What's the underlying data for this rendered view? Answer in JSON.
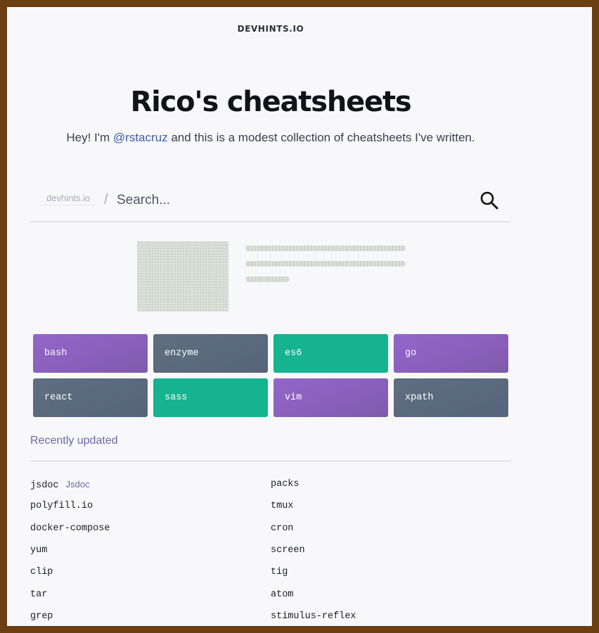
{
  "site": {
    "brand": "DEVHINTS.IO"
  },
  "hero": {
    "title": "Rico's cheatsheets",
    "subtitle_before": "Hey! I'm ",
    "subtitle_link": "@rstacruz",
    "subtitle_after": " and this is a modest collection of cheatsheets I've written."
  },
  "search": {
    "domain_label": "devhints.io",
    "separator": "/",
    "placeholder": "Search...",
    "icon": "search-icon"
  },
  "colors": {
    "purple": "#8a5fbc",
    "slate": "#5a6a7e",
    "green": "#15b38f",
    "link": "#3b5ea8",
    "accent": "#6a68a6"
  },
  "tiles": [
    {
      "label": "bash",
      "color": "purple"
    },
    {
      "label": "enzyme",
      "color": "slate"
    },
    {
      "label": "es6",
      "color": "green"
    },
    {
      "label": "go",
      "color": "purple"
    },
    {
      "label": "react",
      "color": "slate"
    },
    {
      "label": "sass",
      "color": "green"
    },
    {
      "label": "vim",
      "color": "purple"
    },
    {
      "label": "xpath",
      "color": "slate"
    }
  ],
  "recent": {
    "heading": "Recently updated",
    "left": [
      {
        "label": "jsdoc",
        "tag": "Jsdoc"
      },
      {
        "label": "polyfill.io"
      },
      {
        "label": "docker-compose"
      },
      {
        "label": "yum"
      },
      {
        "label": "clip"
      },
      {
        "label": "tar"
      },
      {
        "label": "grep"
      }
    ],
    "right": [
      {
        "label": "packs"
      },
      {
        "label": "tmux"
      },
      {
        "label": "cron"
      },
      {
        "label": "screen"
      },
      {
        "label": "tig"
      },
      {
        "label": "atom"
      },
      {
        "label": "stimulus-reflex"
      }
    ]
  }
}
